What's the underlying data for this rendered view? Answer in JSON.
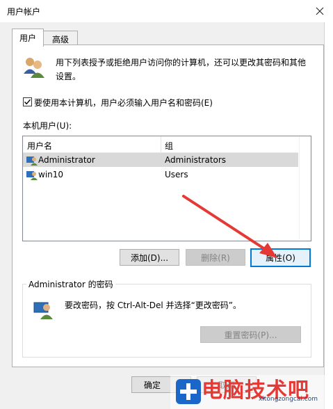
{
  "window": {
    "title": "用户帐户"
  },
  "tabs": [
    {
      "label": "用户"
    },
    {
      "label": "高级"
    }
  ],
  "description": "用下列表授予或拒绝用户访问你的计算机，还可以更改其密码和其他设置。",
  "require_login": {
    "label": "要使用本计算机，用户必须输入用户名和密码(E)",
    "checked": true
  },
  "users_section": {
    "label": "本机用户(U):"
  },
  "table": {
    "columns": [
      "用户名",
      "组"
    ],
    "rows": [
      {
        "name": "Administrator",
        "group": "Administrators",
        "selected": true,
        "icon": "user-group-icon"
      },
      {
        "name": "win10",
        "group": "Users",
        "selected": false,
        "icon": "user-group-icon"
      }
    ]
  },
  "buttons": {
    "add": "添加(D)...",
    "remove": "删除(R)",
    "properties": "属性(O)"
  },
  "password_group": {
    "title": "Administrator 的密码",
    "text": "要改密码，按 Ctrl-Alt-Del 并选择“更改密码”。",
    "reset_button": "重置密码(P)..."
  },
  "footer": {
    "ok": "确定",
    "cancel": "取消"
  },
  "watermark": {
    "brand": "电脑技术吧",
    "url": "xitongzongcai.com"
  },
  "colors": {
    "accent": "#0078d7",
    "arrow": "#e53935"
  }
}
